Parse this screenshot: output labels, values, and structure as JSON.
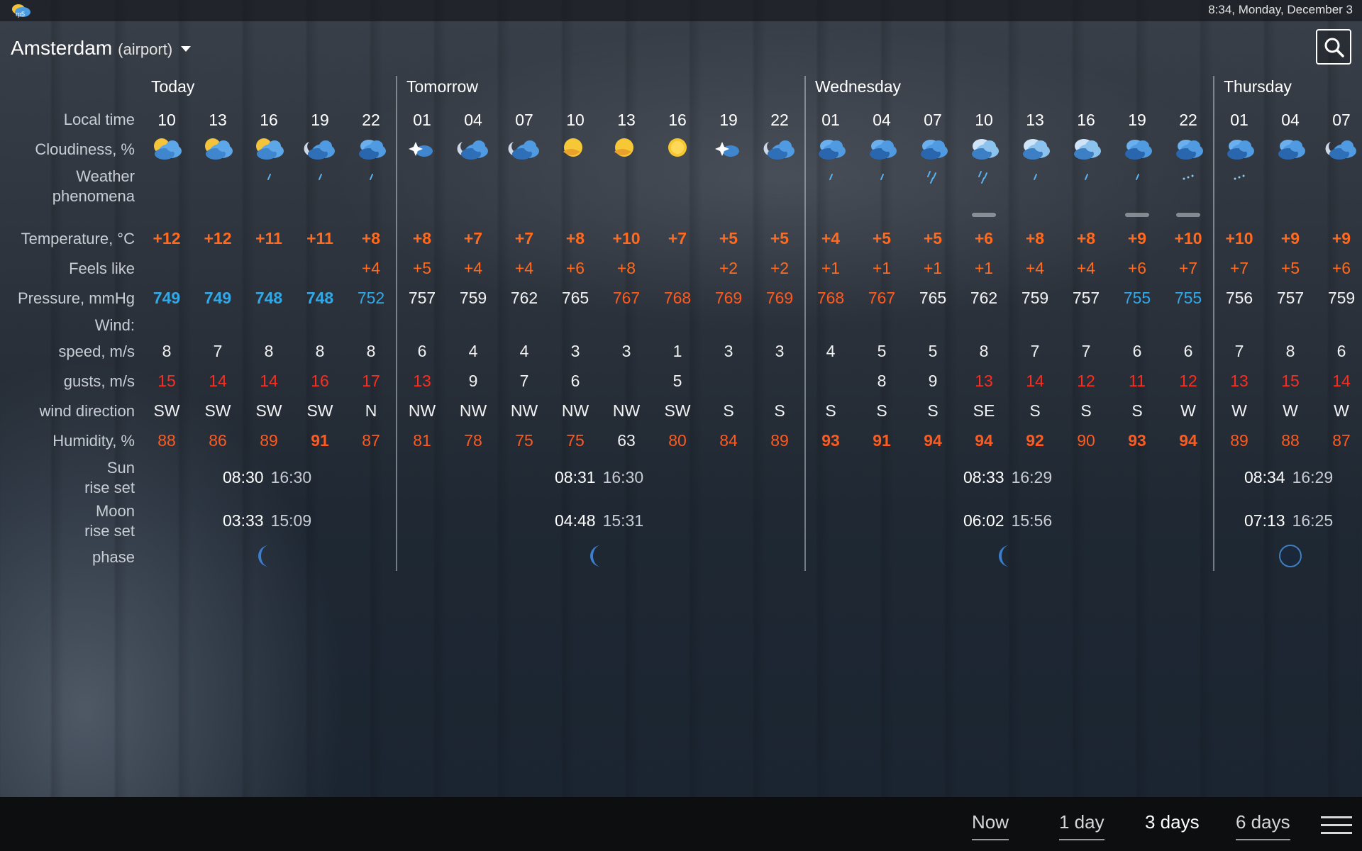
{
  "status_bar": {
    "clock": "8:34, Monday, December 3",
    "logo_icon": "app-logo-icon",
    "logo_text": "rp5"
  },
  "location": {
    "city": "Amsterdam",
    "qualifier": "(airport)"
  },
  "row_labels": {
    "local_time": "Local time",
    "cloudiness": "Cloudiness, %",
    "weather_1": "Weather",
    "weather_2": "phenomena",
    "temperature": "Temperature, °C",
    "feels_like": "Feels like",
    "pressure": "Pressure, mmHg",
    "wind": "Wind:",
    "speed": "speed, m/s",
    "gusts": "gusts, m/s",
    "direction": "wind direction",
    "humidity": "Humidity, %",
    "sun_1": "Sun",
    "sun_2": "rise set",
    "moon_1": "Moon",
    "moon_2": "rise set",
    "phase": "phase"
  },
  "days": [
    {
      "name": "Today",
      "sunrise": "08:30",
      "sunset": "16:30",
      "moonrise": "03:33",
      "moonset": "15:09",
      "moon_phase": "waning-crescent"
    },
    {
      "name": "Tomorrow",
      "sunrise": "08:31",
      "sunset": "16:30",
      "moonrise": "04:48",
      "moonset": "15:31",
      "moon_phase": "waning-crescent"
    },
    {
      "name": "Wednesday",
      "sunrise": "08:33",
      "sunset": "16:29",
      "moonrise": "06:02",
      "moonset": "15:56",
      "moon_phase": "waning-crescent"
    },
    {
      "name": "Thursday",
      "sunrise": "08:34",
      "sunset": "16:29",
      "moonrise": "07:13",
      "moonset": "16:25",
      "moon_phase": "new-moon"
    }
  ],
  "hours": [
    {
      "t": "10",
      "sky": "partly-cloudy-day",
      "precip": "",
      "temp": "+12",
      "feels": "",
      "press": "749",
      "pc": "p-blue-b",
      "speed": "8",
      "gust": "15",
      "gc": "g-red",
      "dir": "SW",
      "hum": "88",
      "hc": "h-orange"
    },
    {
      "t": "13",
      "sky": "partly-cloudy-day",
      "precip": "",
      "temp": "+12",
      "feels": "",
      "press": "749",
      "pc": "p-blue-b",
      "speed": "7",
      "gust": "14",
      "gc": "g-red",
      "dir": "SW",
      "hum": "86",
      "hc": "h-orange"
    },
    {
      "t": "16",
      "sky": "partly-cloudy-day",
      "precip": "light-rain",
      "temp": "+11",
      "feels": "",
      "press": "748",
      "pc": "p-blue-b",
      "speed": "8",
      "gust": "14",
      "gc": "g-red",
      "dir": "SW",
      "hum": "89",
      "hc": "h-orange"
    },
    {
      "t": "19",
      "sky": "cloudy-night",
      "precip": "light-rain",
      "temp": "+11",
      "feels": "",
      "press": "748",
      "pc": "p-blue-b",
      "speed": "8",
      "gust": "16",
      "gc": "g-red",
      "dir": "SW",
      "hum": "91",
      "hc": "h-orange-b"
    },
    {
      "t": "22",
      "sky": "overcast",
      "precip": "light-rain",
      "temp": "+8",
      "feels": "+4",
      "press": "752",
      "pc": "p-blue",
      "speed": "8",
      "gust": "17",
      "gc": "g-red",
      "dir": "N",
      "hum": "87",
      "hc": "h-orange"
    },
    {
      "t": "01",
      "sky": "clear-night-stars",
      "precip": "",
      "temp": "+8",
      "feels": "+5",
      "press": "757",
      "pc": "p-white",
      "speed": "6",
      "gust": "13",
      "gc": "g-red",
      "dir": "NW",
      "hum": "81",
      "hc": "h-orange"
    },
    {
      "t": "04",
      "sky": "cloudy-night",
      "precip": "",
      "temp": "+7",
      "feels": "+4",
      "press": "759",
      "pc": "p-white",
      "speed": "4",
      "gust": "9",
      "gc": "g-white",
      "dir": "NW",
      "hum": "78",
      "hc": "h-orange"
    },
    {
      "t": "07",
      "sky": "cloudy-night",
      "precip": "",
      "temp": "+7",
      "feels": "+4",
      "press": "762",
      "pc": "p-white",
      "speed": "4",
      "gust": "7",
      "gc": "g-white",
      "dir": "NW",
      "hum": "75",
      "hc": "h-orange"
    },
    {
      "t": "10",
      "sky": "partly-sunny",
      "precip": "",
      "temp": "+8",
      "feels": "+6",
      "press": "765",
      "pc": "p-white",
      "speed": "3",
      "gust": "6",
      "gc": "g-white",
      "dir": "NW",
      "hum": "75",
      "hc": "h-orange"
    },
    {
      "t": "13",
      "sky": "partly-sunny",
      "precip": "",
      "temp": "+10",
      "feels": "+8",
      "press": "767",
      "pc": "p-orange",
      "speed": "3",
      "gust": "",
      "gc": "g-white",
      "dir": "NW",
      "hum": "63",
      "hc": "h-white"
    },
    {
      "t": "16",
      "sky": "sunny",
      "precip": "",
      "temp": "+7",
      "feels": "",
      "press": "768",
      "pc": "p-orange",
      "speed": "1",
      "gust": "5",
      "gc": "g-white",
      "dir": "SW",
      "hum": "80",
      "hc": "h-orange"
    },
    {
      "t": "19",
      "sky": "clear-night-stars",
      "precip": "",
      "temp": "+5",
      "feels": "+2",
      "press": "769",
      "pc": "p-orange",
      "speed": "3",
      "gust": "",
      "gc": "g-white",
      "dir": "S",
      "hum": "84",
      "hc": "h-orange"
    },
    {
      "t": "22",
      "sky": "cloudy-night",
      "precip": "",
      "temp": "+5",
      "feels": "+2",
      "press": "769",
      "pc": "p-orange",
      "speed": "3",
      "gust": "",
      "gc": "g-white",
      "dir": "S",
      "hum": "89",
      "hc": "h-orange"
    },
    {
      "t": "01",
      "sky": "overcast",
      "precip": "light-rain",
      "temp": "+4",
      "feels": "+1",
      "press": "768",
      "pc": "p-orange",
      "speed": "4",
      "gust": "",
      "gc": "g-white",
      "dir": "S",
      "hum": "93",
      "hc": "h-orange-b"
    },
    {
      "t": "04",
      "sky": "overcast",
      "precip": "light-rain",
      "temp": "+5",
      "feels": "+1",
      "press": "767",
      "pc": "p-orange",
      "speed": "5",
      "gust": "8",
      "gc": "g-white",
      "dir": "S",
      "hum": "91",
      "hc": "h-orange-b"
    },
    {
      "t": "07",
      "sky": "overcast",
      "precip": "rain",
      "temp": "+5",
      "feels": "+1",
      "press": "765",
      "pc": "p-white",
      "speed": "5",
      "gust": "9",
      "gc": "g-white",
      "dir": "S",
      "hum": "94",
      "hc": "h-orange-b"
    },
    {
      "t": "10",
      "sky": "overcast-heavy",
      "precip": "rain-fog",
      "temp": "+6",
      "feels": "+1",
      "press": "762",
      "pc": "p-white",
      "speed": "8",
      "gust": "13",
      "gc": "g-red",
      "dir": "SE",
      "hum": "94",
      "hc": "h-orange-b"
    },
    {
      "t": "13",
      "sky": "overcast-heavy",
      "precip": "light-rain",
      "temp": "+8",
      "feels": "+4",
      "press": "759",
      "pc": "p-white",
      "speed": "7",
      "gust": "14",
      "gc": "g-red",
      "dir": "S",
      "hum": "92",
      "hc": "h-orange-b"
    },
    {
      "t": "16",
      "sky": "overcast-heavy",
      "precip": "light-rain",
      "temp": "+8",
      "feels": "+4",
      "press": "757",
      "pc": "p-white",
      "speed": "7",
      "gust": "12",
      "gc": "g-red",
      "dir": "S",
      "hum": "90",
      "hc": "h-orange"
    },
    {
      "t": "19",
      "sky": "overcast",
      "precip": "light-rain-fog",
      "temp": "+9",
      "feels": "+6",
      "press": "755",
      "pc": "p-blue",
      "speed": "6",
      "gust": "11",
      "gc": "g-red",
      "dir": "S",
      "hum": "93",
      "hc": "h-orange-b"
    },
    {
      "t": "22",
      "sky": "overcast",
      "precip": "drizzle-fog",
      "temp": "+10",
      "feels": "+7",
      "press": "755",
      "pc": "p-blue",
      "speed": "6",
      "gust": "12",
      "gc": "g-red",
      "dir": "W",
      "hum": "94",
      "hc": "h-orange-b"
    },
    {
      "t": "01",
      "sky": "overcast",
      "precip": "drizzle",
      "temp": "+10",
      "feels": "+7",
      "press": "756",
      "pc": "p-white",
      "speed": "7",
      "gust": "13",
      "gc": "g-red",
      "dir": "W",
      "hum": "89",
      "hc": "h-orange"
    },
    {
      "t": "04",
      "sky": "overcast",
      "precip": "",
      "temp": "+9",
      "feels": "+5",
      "press": "757",
      "pc": "p-white",
      "speed": "8",
      "gust": "15",
      "gc": "g-red",
      "dir": "W",
      "hum": "88",
      "hc": "h-orange"
    },
    {
      "t": "07",
      "sky": "cloudy-night",
      "precip": "",
      "temp": "+9",
      "feels": "+6",
      "press": "759",
      "pc": "p-white",
      "speed": "6",
      "gust": "14",
      "gc": "g-red",
      "dir": "W",
      "hum": "87",
      "hc": "h-orange"
    }
  ],
  "tabs": [
    {
      "label": "Now",
      "active": false
    },
    {
      "label": "1 day",
      "active": false
    },
    {
      "label": "3 days",
      "active": true
    },
    {
      "label": "6 days",
      "active": false
    }
  ],
  "icons": {
    "search": "search-icon",
    "menu": "hamburger-menu-icon",
    "dropdown": "chevron-down-icon"
  },
  "colors": {
    "temp": "#ff6a1e",
    "pressure_low": "#33a8e6",
    "pressure_high": "#ff5a1e",
    "gust_high": "#ff2b1e"
  }
}
